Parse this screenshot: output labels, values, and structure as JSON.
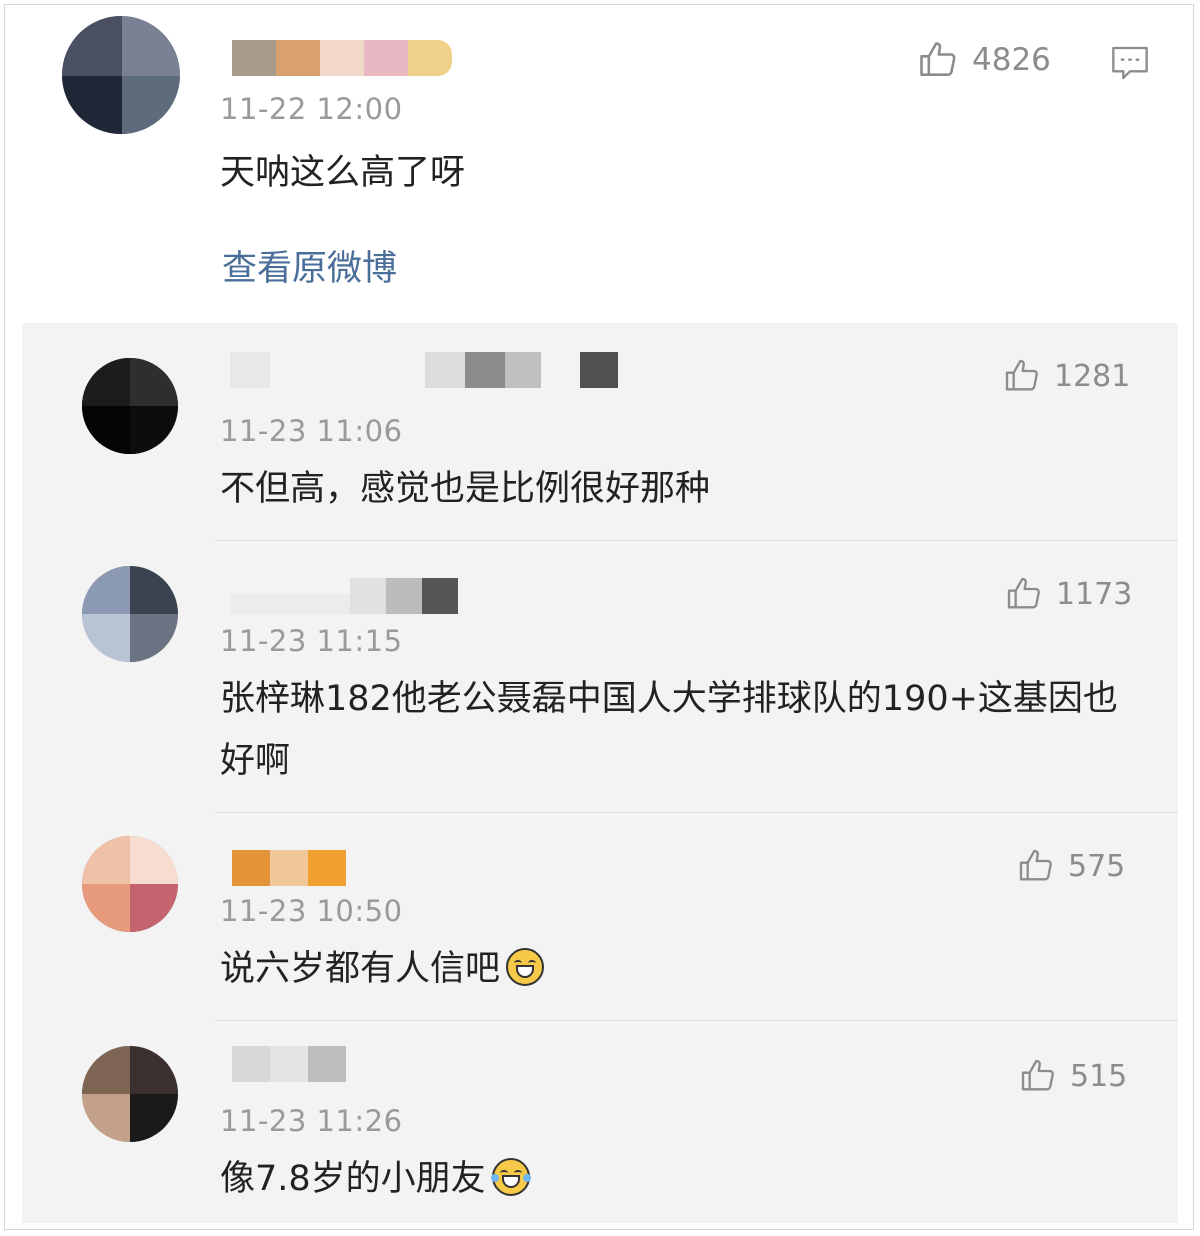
{
  "main": {
    "timestamp": "11-22 12:00",
    "text": "天呐这么高了呀",
    "likes": "4826",
    "view_link": "查看原微博",
    "avatar_colors": [
      "#3d4350",
      "#6a6f82",
      "#1f2a3c",
      "#5b6a7d"
    ],
    "name_block_colors": [
      "#a89b8b",
      "#d9a070",
      "#f2d8c8",
      "#e8b9c2",
      "#f0d18a"
    ]
  },
  "replies": [
    {
      "timestamp": "11-23 11:06",
      "text": "不但高，感觉也是比例很好那种",
      "likes": "1281",
      "avatar_colors": [
        "#111111",
        "#333333",
        "#777777",
        "#0a0a0a"
      ],
      "name_block_colors": [
        "#e8e8e8",
        "#d8d8d8",
        "#8c8c8c",
        "#c0c0c0",
        "#505050"
      ]
    },
    {
      "timestamp": "11-23 11:15",
      "text": "张梓琳182他老公聂磊中国人大学排球队的190+这基因也好啊",
      "likes": "1173",
      "avatar_colors": [
        "#7f8fa8",
        "#b5c2d4",
        "#5d6572",
        "#2a2f38"
      ],
      "name_block_colors": [
        "#ececec",
        "#d4d4d4",
        "#555555"
      ]
    },
    {
      "timestamp": "11-23 10:50",
      "text": "说六岁都有人信吧",
      "likes": "575",
      "avatar_colors": [
        "#e8a58a",
        "#f5d3c4",
        "#c4646e",
        "#d98d72"
      ],
      "name_block_colors": [
        "#e4953a",
        "#f0c79a",
        "#f0a030"
      ]
    },
    {
      "timestamp": "11-23 11:26",
      "text": "像7.8岁的小朋友",
      "likes": "515",
      "avatar_colors": [
        "#8a6a55",
        "#1a1a1a",
        "#c2a08a",
        "#3a3030"
      ],
      "name_block_colors": [
        "#d8d8d8",
        "#e4e4e4",
        "#bdbdbd"
      ]
    }
  ]
}
